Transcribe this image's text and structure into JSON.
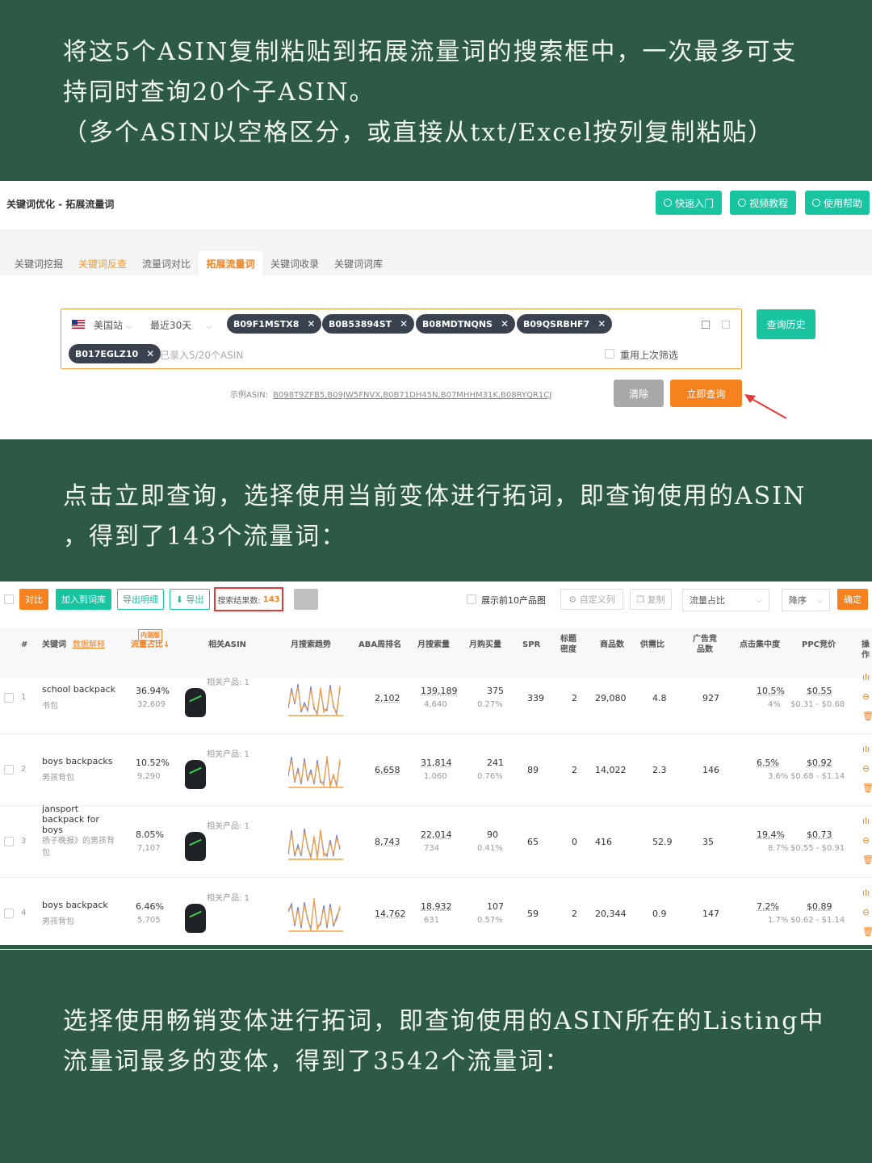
{
  "captions": {
    "intro_line1": "将这5个ASIN复制粘贴到拓展流量词的搜索框中，一次最多可支",
    "intro_line2": "持同时查询20个子ASIN。",
    "intro_line3": "（多个ASIN以空格区分，或直接从txt/Excel按列复制粘贴）",
    "mid_line1": "点击立即查询，选择使用当前变体进行拓词，即查询使用的ASIN",
    "mid_line2": "，得到了143个流量词：",
    "end_line1": "选择使用畅销变体进行拓词，即查询使用的ASIN所在的Listing中",
    "end_line2": "流量词最多的变体，得到了3542个流量词："
  },
  "panel1": {
    "title": "关键词优化 - 拓展流量词",
    "header_buttons": [
      "快速入门",
      "视频教程",
      "使用帮助"
    ],
    "tabs": [
      "关键词挖掘",
      "关键词反查",
      "流量词对比",
      "拓展流量词",
      "关键词收录",
      "关键词词库"
    ],
    "marketplace": "美国站",
    "period": "最近30天",
    "asins": [
      "B09F1MSTX8",
      "B0B53894ST",
      "B08MDTNQNS",
      "B09QSRBHF7",
      "B017EGLZ10"
    ],
    "asin_count_hint": "已录入5/20个ASIN",
    "reuse_filter_label": "重用上次筛选",
    "query_history": "查询历史",
    "example_label": "示例ASIN:",
    "example_asins": "B098T9ZFB5,B09JW5FNVX,B0B71DH45N,B07MHHM31K,B08RYQR1CJ",
    "clear_button": "清除",
    "query_button": "立即查询"
  },
  "panel2": {
    "toolbar": {
      "compare": "对比",
      "add_to_lib": "加入到词库",
      "export_detail": "导出明细",
      "export": "导出",
      "result_label": "搜索结果数:",
      "result_count": "143",
      "show_top10": "展示前10产品图",
      "custom_columns": "自定义列",
      "copy": "复制",
      "sort_field": "流量占比",
      "sort_order": "降序",
      "confirm": "确定"
    },
    "headers": {
      "index": "#",
      "keyword": "关键词",
      "data_explain": "数据解释",
      "beta_badge": "内测版",
      "traffic_share": "流量占比↓",
      "related_asin": "相关ASIN",
      "monthly_trend": "月搜索趋势",
      "aba_rank": "ABA周排名",
      "monthly_search": "月搜索量",
      "monthly_purchase": "月购买量",
      "spr": "SPR",
      "title_density": "标题密度",
      "product_count": "商品数",
      "supply_demand": "供需比",
      "ad_products": "广告竞品数",
      "click_concentration": "点击集中度",
      "ppc_bid": "PPC竞价",
      "actions": "操作"
    },
    "related_prefix": "相关产品: 1",
    "rows": [
      {
        "index": "1",
        "keyword": "school backpack",
        "keyword_cn": "书包",
        "share": "36.94%",
        "share_sub": "32,609",
        "aba": "2,102",
        "search": "139,189",
        "search_sub": "4,640",
        "purchase": "375",
        "purchase_sub": "0.27%",
        "spr": "339",
        "density": "2",
        "products": "29,080",
        "ratio": "4.8",
        "ads": "927",
        "click": "10.5%",
        "click_sub": "4%",
        "ppc": "$0.55",
        "ppc_range": "$0.31 - $0.68"
      },
      {
        "index": "2",
        "keyword": "boys backpacks",
        "keyword_cn": "男孩背包",
        "share": "10.52%",
        "share_sub": "9,290",
        "aba": "6,658",
        "search": "31,814",
        "search_sub": "1,060",
        "purchase": "241",
        "purchase_sub": "0.76%",
        "spr": "89",
        "density": "2",
        "products": "14,022",
        "ratio": "2.3",
        "ads": "146",
        "click": "6.5%",
        "click_sub": "3.6%",
        "ppc": "$0.92",
        "ppc_range": "$0.68 - $1.14"
      },
      {
        "index": "3",
        "keyword": "jansport backpack for boys",
        "keyword_cn": "扬子晚报》的男孩背包",
        "share": "8.05%",
        "share_sub": "7,107",
        "aba": "8,743",
        "search": "22,014",
        "search_sub": "734",
        "purchase": "90",
        "purchase_sub": "0.41%",
        "spr": "65",
        "density": "0",
        "products": "416",
        "ratio": "52.9",
        "ads": "35",
        "click": "19.4%",
        "click_sub": "8.7%",
        "ppc": "$0.73",
        "ppc_range": "$0.55 - $0.91"
      },
      {
        "index": "4",
        "keyword": "boys backpack",
        "keyword_cn": "男孩背包",
        "share": "6.46%",
        "share_sub": "5,705",
        "aba": "14,762",
        "search": "18,932",
        "search_sub": "631",
        "purchase": "107",
        "purchase_sub": "0.57%",
        "spr": "59",
        "density": "2",
        "products": "20,344",
        "ratio": "0.9",
        "ads": "147",
        "click": "7.2%",
        "click_sub": "1.7%",
        "ppc": "$0.89",
        "ppc_range": "$0.62 - $1.14"
      }
    ]
  },
  "colors": {
    "background": "#2d5a44",
    "accent_green": "#19c4a0",
    "accent_orange": "#f5821f",
    "highlight_red": "#e53935"
  }
}
